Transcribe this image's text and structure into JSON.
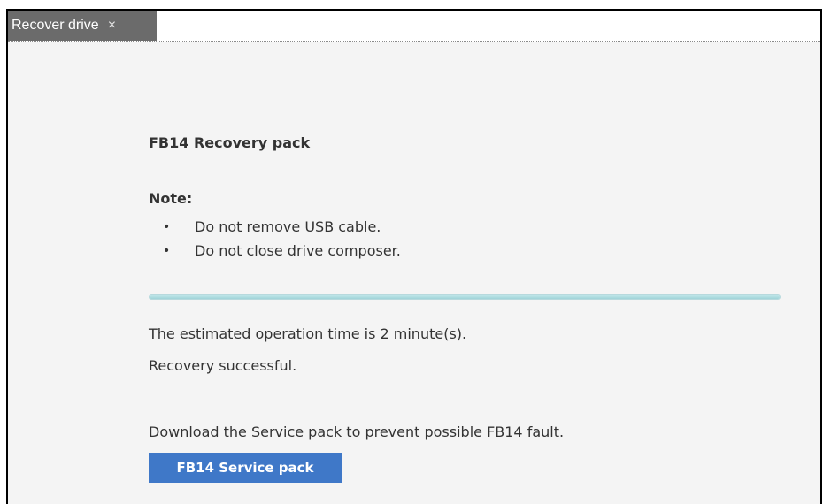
{
  "tab": {
    "label": "Recover drive",
    "close_icon": "close-icon",
    "close_glyph": "×"
  },
  "panel": {
    "title": "FB14 Recovery pack",
    "note_label": "Note:",
    "notes": [
      "Do not remove USB cable.",
      "Do not close drive composer."
    ],
    "bullet_glyph": "•",
    "progress_fraction": 1.0,
    "estimate_text": "The estimated operation time is 2 minute(s).",
    "status_text": "Recovery successful.",
    "download_text": "Download the Service pack to prevent possible FB14 fault.",
    "service_button_label": "FB14 Service pack"
  },
  "colors": {
    "tab_background": "#6b6b6b",
    "button_background": "#3f78c8",
    "progress": "#a8d8dc",
    "text": "#333333"
  }
}
